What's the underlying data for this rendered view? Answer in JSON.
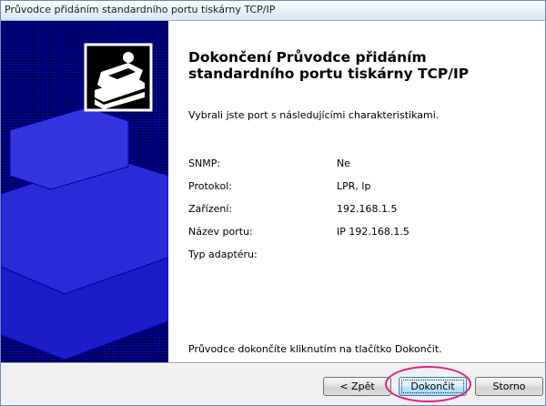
{
  "window": {
    "title": "Průvodce přidáním standardního portu tiskárny TCP/IP"
  },
  "heading": "Dokončení Průvodce přidáním standardního portu tiskárny TCP/IP",
  "intro": "Vybrali jste port s následujícími charakteristikami.",
  "properties": [
    {
      "label": "SNMP:",
      "value": "Ne"
    },
    {
      "label": "Protokol:",
      "value": "LPR, lp"
    },
    {
      "label": "Zařízení:",
      "value": "192.168.1.5"
    },
    {
      "label": "Název portu:",
      "value": "IP 192.168.1.5"
    },
    {
      "label": "Typ adaptéru:",
      "value": ""
    }
  ],
  "footer_note": "Průvodce dokončíte kliknutím na tlačítko Dokončit.",
  "buttons": {
    "back": "< Zpět",
    "finish": "Dokončit",
    "cancel": "Storno"
  },
  "colors": {
    "sidebar": "#0000cc",
    "highlight": "#e0207f",
    "titlebar": "#d9e6f5"
  },
  "icons": {
    "sidebar_art": "printer-port-icon"
  }
}
